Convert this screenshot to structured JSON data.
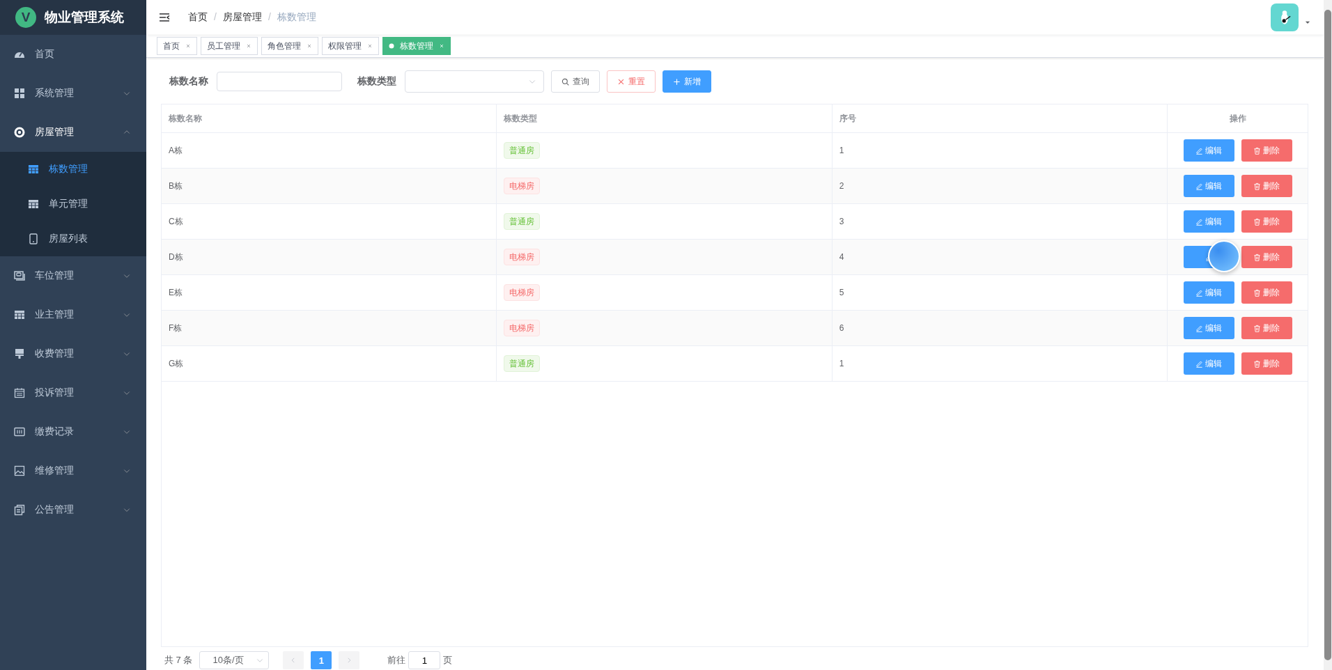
{
  "app": {
    "title": "物业管理系统",
    "logo_letter": "V"
  },
  "sidebar": {
    "items": [
      {
        "label": "首页",
        "selected": false
      },
      {
        "label": "系统管理",
        "expanded": false,
        "selected": false
      },
      {
        "label": "房屋管理",
        "expanded": true,
        "selected": false,
        "children": [
          {
            "label": "栋数管理",
            "selected": true
          },
          {
            "label": "单元管理",
            "selected": false
          },
          {
            "label": "房屋列表",
            "selected": false
          }
        ]
      },
      {
        "label": "车位管理",
        "expanded": false,
        "selected": false
      },
      {
        "label": "业主管理",
        "expanded": false,
        "selected": false
      },
      {
        "label": "收费管理",
        "expanded": false,
        "selected": false
      },
      {
        "label": "投诉管理",
        "expanded": false,
        "selected": false
      },
      {
        "label": "缴费记录",
        "expanded": false,
        "selected": false
      },
      {
        "label": "维修管理",
        "expanded": false,
        "selected": false
      },
      {
        "label": "公告管理",
        "expanded": false,
        "selected": false
      }
    ]
  },
  "breadcrumb": {
    "separator": "/",
    "items": [
      "首页",
      "房屋管理",
      "栋数管理"
    ]
  },
  "tabs": [
    {
      "label": "首页",
      "selected": false
    },
    {
      "label": "员工管理",
      "selected": false
    },
    {
      "label": "角色管理",
      "selected": false
    },
    {
      "label": "权限管理",
      "selected": false
    },
    {
      "label": "栋数管理",
      "selected": true
    }
  ],
  "filters": [
    {
      "label": "栋数名称",
      "kind": "input"
    },
    {
      "label": "栋数类型",
      "kind": "select"
    }
  ],
  "filter_buttons": [
    {
      "label": "查询",
      "kind": "search"
    },
    {
      "label": "重置",
      "kind": "reset"
    },
    {
      "label": "新增",
      "kind": "add"
    }
  ],
  "table": {
    "columns": [
      "栋数名称",
      "栋数类型",
      "序号",
      "操作"
    ],
    "rows": [
      {
        "name": "A栋",
        "type": {
          "label": "普通房",
          "kind": "success"
        },
        "order": "1",
        "edit_label": "编辑",
        "delete_label": "删除"
      },
      {
        "name": "B栋",
        "type": {
          "label": "电梯房",
          "kind": "danger"
        },
        "order": "2",
        "edit_label": "编辑",
        "delete_label": "删除"
      },
      {
        "name": "C栋",
        "type": {
          "label": "普通房",
          "kind": "success"
        },
        "order": "3",
        "edit_label": "编辑",
        "delete_label": "删除"
      },
      {
        "name": "D栋",
        "type": {
          "label": "电梯房",
          "kind": "danger"
        },
        "order": "4",
        "delete_label": "删除"
      },
      {
        "name": "E栋",
        "type": {
          "label": "电梯房",
          "kind": "danger"
        },
        "order": "5",
        "edit_label": "编辑",
        "delete_label": "删除"
      },
      {
        "name": "F栋",
        "type": {
          "label": "电梯房",
          "kind": "danger"
        },
        "order": "6",
        "edit_label": "编辑",
        "delete_label": "删除"
      },
      {
        "name": "G栋",
        "type": {
          "label": "普通房",
          "kind": "success"
        },
        "order": "1",
        "edit_label": "编辑",
        "delete_label": "删除"
      }
    ]
  },
  "pagination": {
    "total": "共 7 条",
    "page_size": "10条/页",
    "pages": [
      {
        "label": "1",
        "selected": true
      }
    ],
    "goto_label": "前往",
    "goto_value": "1",
    "goto_suffix": "页"
  }
}
